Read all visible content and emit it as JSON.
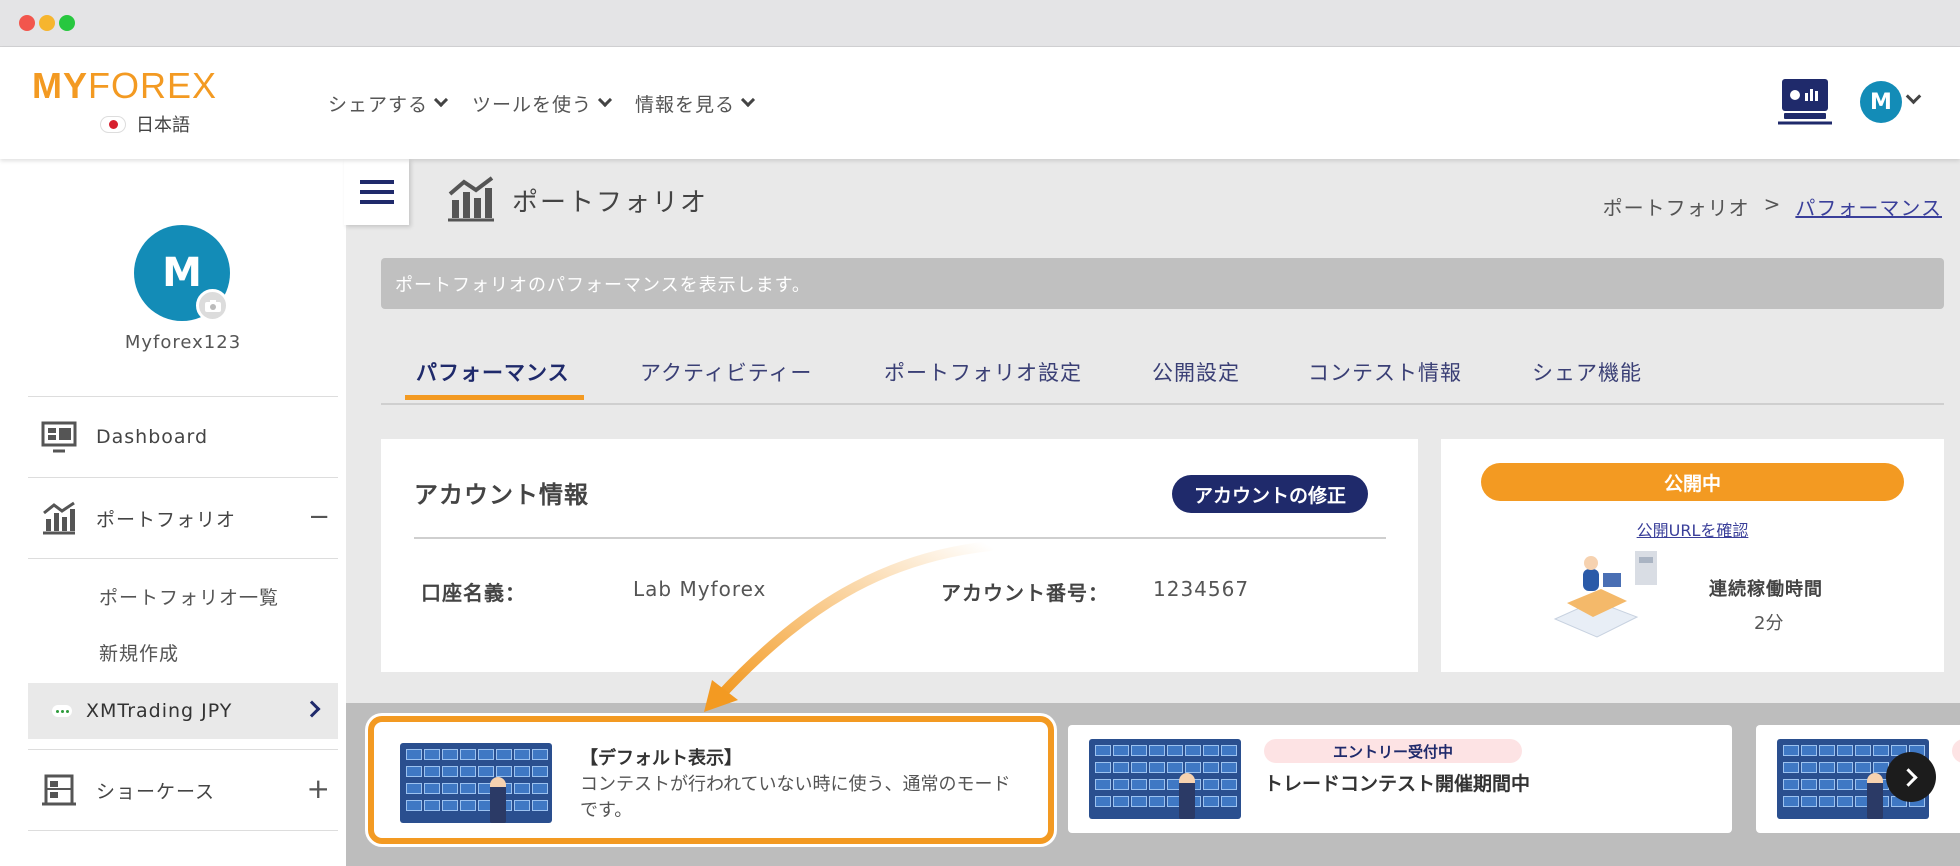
{
  "logo": {
    "text_my": "MY",
    "text_forex": "FOREX",
    "language": "日本語"
  },
  "nav": [
    {
      "label": "シェアする"
    },
    {
      "label": "ツールを使う"
    },
    {
      "label": "情報を見る"
    }
  ],
  "header_avatar": {
    "initial": "M"
  },
  "sidebar": {
    "avatar_initial": "M",
    "username": "Myforex123",
    "items": [
      {
        "label": "Dashboard"
      },
      {
        "label": "ポートフォリオ",
        "toggle": "−"
      },
      {
        "label": "ポートフォリオ一覧"
      },
      {
        "label": "新規作成"
      },
      {
        "label": "XMTrading JPY"
      },
      {
        "label": "ショーケース",
        "toggle": "+"
      }
    ]
  },
  "page": {
    "title": "ポートフォリオ",
    "breadcrumb_parent": "ポートフォリオ",
    "breadcrumb_sep": ">",
    "breadcrumb_current": "パフォーマンス",
    "info_banner": "ポートフォリオのパフォーマンスを表示します。"
  },
  "tabs": [
    {
      "label": "パフォーマンス",
      "active": true
    },
    {
      "label": "アクティビティー"
    },
    {
      "label": "ポートフォリオ設定"
    },
    {
      "label": "公開設定"
    },
    {
      "label": "コンテスト情報"
    },
    {
      "label": "シェア機能"
    }
  ],
  "account": {
    "title": "アカウント情報",
    "edit_button": "アカウントの修正",
    "name_label": "口座名義：",
    "name_value": "Lab Myforex",
    "number_label": "アカウント番号：",
    "number_value": "1234567"
  },
  "status": {
    "public_badge": "公開中",
    "public_url_link": "公開URLを確認",
    "uptime_label": "連続稼働時間",
    "uptime_value": "2分"
  },
  "carousel": [
    {
      "title": "【デフォルト表示】",
      "desc": "コンテストが行われていない時に使う、通常のモードです。"
    },
    {
      "badge": "エントリー受付中",
      "title": "トレードコンテスト開催期間中"
    },
    {
      "badge": ""
    }
  ],
  "colors": {
    "brand_orange": "#f39a22",
    "navy": "#1f2a6b",
    "avatar_blue": "#138cb7"
  }
}
